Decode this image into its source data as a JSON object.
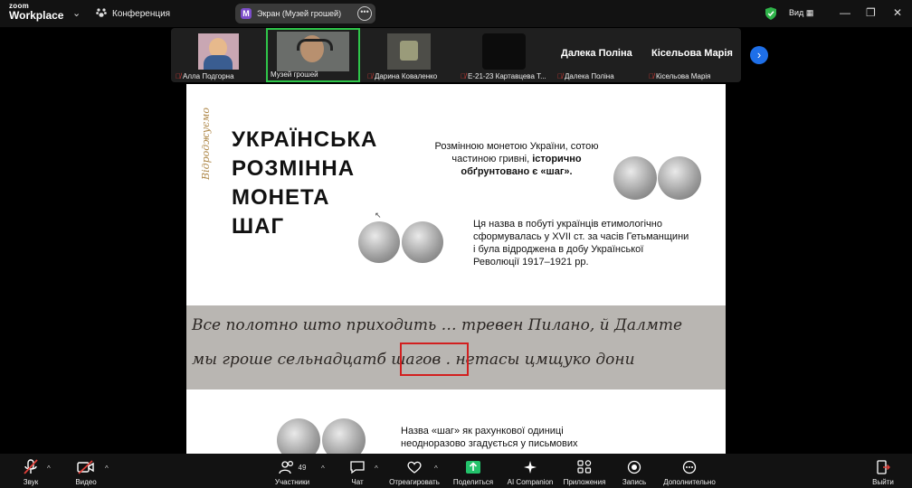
{
  "topbar": {
    "logo_top": "zoom",
    "logo_bottom": "Workplace",
    "conference": "Конференция",
    "screen_badge": "M",
    "screen_title": "Экран (Музей грошей)",
    "view": "Вид",
    "minimize": "—",
    "maximize": "❐",
    "close": "✕"
  },
  "participants": [
    {
      "name": "Алла Подгорна"
    },
    {
      "name": "Музей грошей"
    },
    {
      "name": "Дарина Коваленко"
    },
    {
      "name": "Е-21-23 Картавцева Т..."
    },
    {
      "name": "Далека Поліна",
      "display": "Далека Поліна"
    },
    {
      "name": "Кісельова Марія",
      "display": "Кісельова Марія"
    }
  ],
  "slide": {
    "vertical": "Відроджуємо",
    "title_lines": [
      "УКРАЇНСЬКА",
      "РОЗМІННА",
      "МОНЕТА",
      "ШАГ"
    ],
    "p1_a": "Розмінною монетою України, сотою частиною гривні, ",
    "p1_b": "історично обґрунтовано є «шаг».",
    "p2": "Ця назва в побуті українців етимологічно сформувалась у XVII ст. за часів Гетьманщини і була відроджена в добу Української Революції 1917–1921 рр.",
    "manuscript_line1": "Все полотно што приходить … тревен Пилано, й Далмте",
    "manuscript_line2": "мы гроше сельнадцатб  шагов  . нетасы цмщуко дони",
    "p3": "Назва «шаг» як рахункової одиниці неодноразово згадується у письмових"
  },
  "toolbar": {
    "audio": "Звук",
    "video": "Видео",
    "participants": "Участники",
    "participants_count": "49",
    "chat": "Чат",
    "react": "Отреагировать",
    "share": "Поделиться",
    "companion": "AI Companion",
    "apps": "Приложения",
    "record": "Запись",
    "more": "Дополнительно",
    "leave": "Выйти"
  }
}
